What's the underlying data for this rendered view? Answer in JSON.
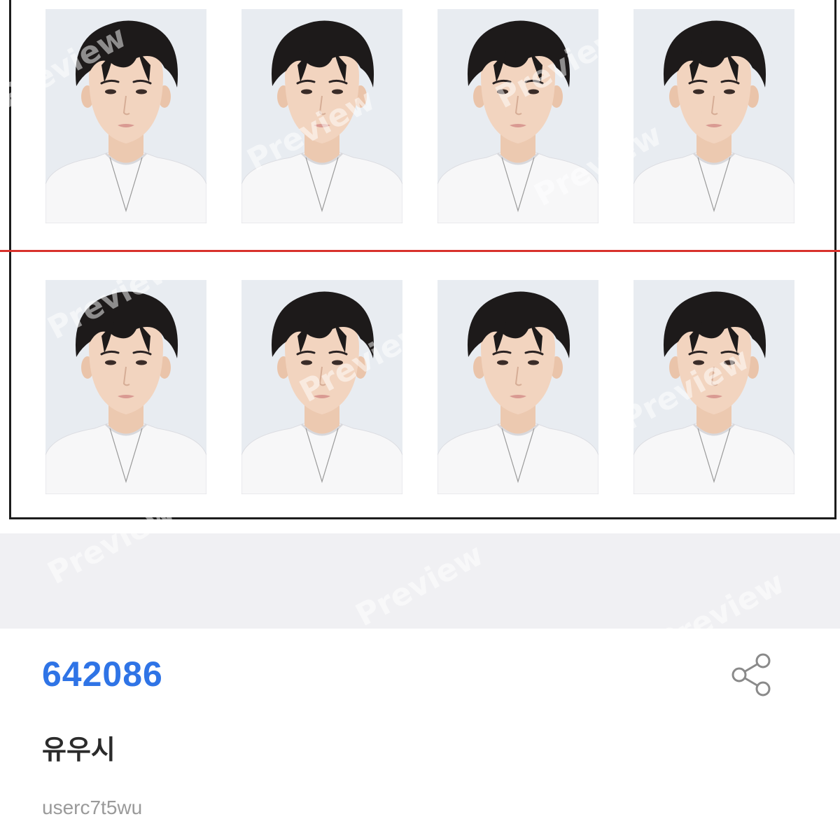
{
  "preview": {
    "watermark_text": "Preview",
    "cut_line_color": "#d8322c",
    "photo_count": 8,
    "photo_background": "#e7ebf0"
  },
  "item": {
    "code": "642086",
    "name": "유우시",
    "user": "userc7t5wu",
    "code_color": "#2f74e6"
  },
  "icons": {
    "share": "share-icon"
  }
}
